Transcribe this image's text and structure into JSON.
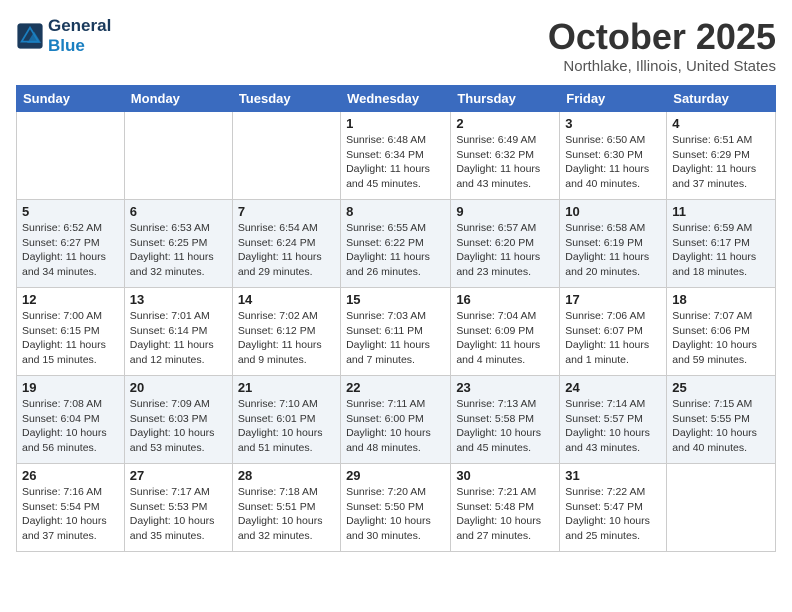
{
  "header": {
    "logo_line1": "General",
    "logo_line2": "Blue",
    "month_title": "October 2025",
    "location": "Northlake, Illinois, United States"
  },
  "days_of_week": [
    "Sunday",
    "Monday",
    "Tuesday",
    "Wednesday",
    "Thursday",
    "Friday",
    "Saturday"
  ],
  "weeks": [
    [
      {
        "day": "",
        "info": ""
      },
      {
        "day": "",
        "info": ""
      },
      {
        "day": "",
        "info": ""
      },
      {
        "day": "1",
        "info": "Sunrise: 6:48 AM\nSunset: 6:34 PM\nDaylight: 11 hours and 45 minutes."
      },
      {
        "day": "2",
        "info": "Sunrise: 6:49 AM\nSunset: 6:32 PM\nDaylight: 11 hours and 43 minutes."
      },
      {
        "day": "3",
        "info": "Sunrise: 6:50 AM\nSunset: 6:30 PM\nDaylight: 11 hours and 40 minutes."
      },
      {
        "day": "4",
        "info": "Sunrise: 6:51 AM\nSunset: 6:29 PM\nDaylight: 11 hours and 37 minutes."
      }
    ],
    [
      {
        "day": "5",
        "info": "Sunrise: 6:52 AM\nSunset: 6:27 PM\nDaylight: 11 hours and 34 minutes."
      },
      {
        "day": "6",
        "info": "Sunrise: 6:53 AM\nSunset: 6:25 PM\nDaylight: 11 hours and 32 minutes."
      },
      {
        "day": "7",
        "info": "Sunrise: 6:54 AM\nSunset: 6:24 PM\nDaylight: 11 hours and 29 minutes."
      },
      {
        "day": "8",
        "info": "Sunrise: 6:55 AM\nSunset: 6:22 PM\nDaylight: 11 hours and 26 minutes."
      },
      {
        "day": "9",
        "info": "Sunrise: 6:57 AM\nSunset: 6:20 PM\nDaylight: 11 hours and 23 minutes."
      },
      {
        "day": "10",
        "info": "Sunrise: 6:58 AM\nSunset: 6:19 PM\nDaylight: 11 hours and 20 minutes."
      },
      {
        "day": "11",
        "info": "Sunrise: 6:59 AM\nSunset: 6:17 PM\nDaylight: 11 hours and 18 minutes."
      }
    ],
    [
      {
        "day": "12",
        "info": "Sunrise: 7:00 AM\nSunset: 6:15 PM\nDaylight: 11 hours and 15 minutes."
      },
      {
        "day": "13",
        "info": "Sunrise: 7:01 AM\nSunset: 6:14 PM\nDaylight: 11 hours and 12 minutes."
      },
      {
        "day": "14",
        "info": "Sunrise: 7:02 AM\nSunset: 6:12 PM\nDaylight: 11 hours and 9 minutes."
      },
      {
        "day": "15",
        "info": "Sunrise: 7:03 AM\nSunset: 6:11 PM\nDaylight: 11 hours and 7 minutes."
      },
      {
        "day": "16",
        "info": "Sunrise: 7:04 AM\nSunset: 6:09 PM\nDaylight: 11 hours and 4 minutes."
      },
      {
        "day": "17",
        "info": "Sunrise: 7:06 AM\nSunset: 6:07 PM\nDaylight: 11 hours and 1 minute."
      },
      {
        "day": "18",
        "info": "Sunrise: 7:07 AM\nSunset: 6:06 PM\nDaylight: 10 hours and 59 minutes."
      }
    ],
    [
      {
        "day": "19",
        "info": "Sunrise: 7:08 AM\nSunset: 6:04 PM\nDaylight: 10 hours and 56 minutes."
      },
      {
        "day": "20",
        "info": "Sunrise: 7:09 AM\nSunset: 6:03 PM\nDaylight: 10 hours and 53 minutes."
      },
      {
        "day": "21",
        "info": "Sunrise: 7:10 AM\nSunset: 6:01 PM\nDaylight: 10 hours and 51 minutes."
      },
      {
        "day": "22",
        "info": "Sunrise: 7:11 AM\nSunset: 6:00 PM\nDaylight: 10 hours and 48 minutes."
      },
      {
        "day": "23",
        "info": "Sunrise: 7:13 AM\nSunset: 5:58 PM\nDaylight: 10 hours and 45 minutes."
      },
      {
        "day": "24",
        "info": "Sunrise: 7:14 AM\nSunset: 5:57 PM\nDaylight: 10 hours and 43 minutes."
      },
      {
        "day": "25",
        "info": "Sunrise: 7:15 AM\nSunset: 5:55 PM\nDaylight: 10 hours and 40 minutes."
      }
    ],
    [
      {
        "day": "26",
        "info": "Sunrise: 7:16 AM\nSunset: 5:54 PM\nDaylight: 10 hours and 37 minutes."
      },
      {
        "day": "27",
        "info": "Sunrise: 7:17 AM\nSunset: 5:53 PM\nDaylight: 10 hours and 35 minutes."
      },
      {
        "day": "28",
        "info": "Sunrise: 7:18 AM\nSunset: 5:51 PM\nDaylight: 10 hours and 32 minutes."
      },
      {
        "day": "29",
        "info": "Sunrise: 7:20 AM\nSunset: 5:50 PM\nDaylight: 10 hours and 30 minutes."
      },
      {
        "day": "30",
        "info": "Sunrise: 7:21 AM\nSunset: 5:48 PM\nDaylight: 10 hours and 27 minutes."
      },
      {
        "day": "31",
        "info": "Sunrise: 7:22 AM\nSunset: 5:47 PM\nDaylight: 10 hours and 25 minutes."
      },
      {
        "day": "",
        "info": ""
      }
    ]
  ]
}
